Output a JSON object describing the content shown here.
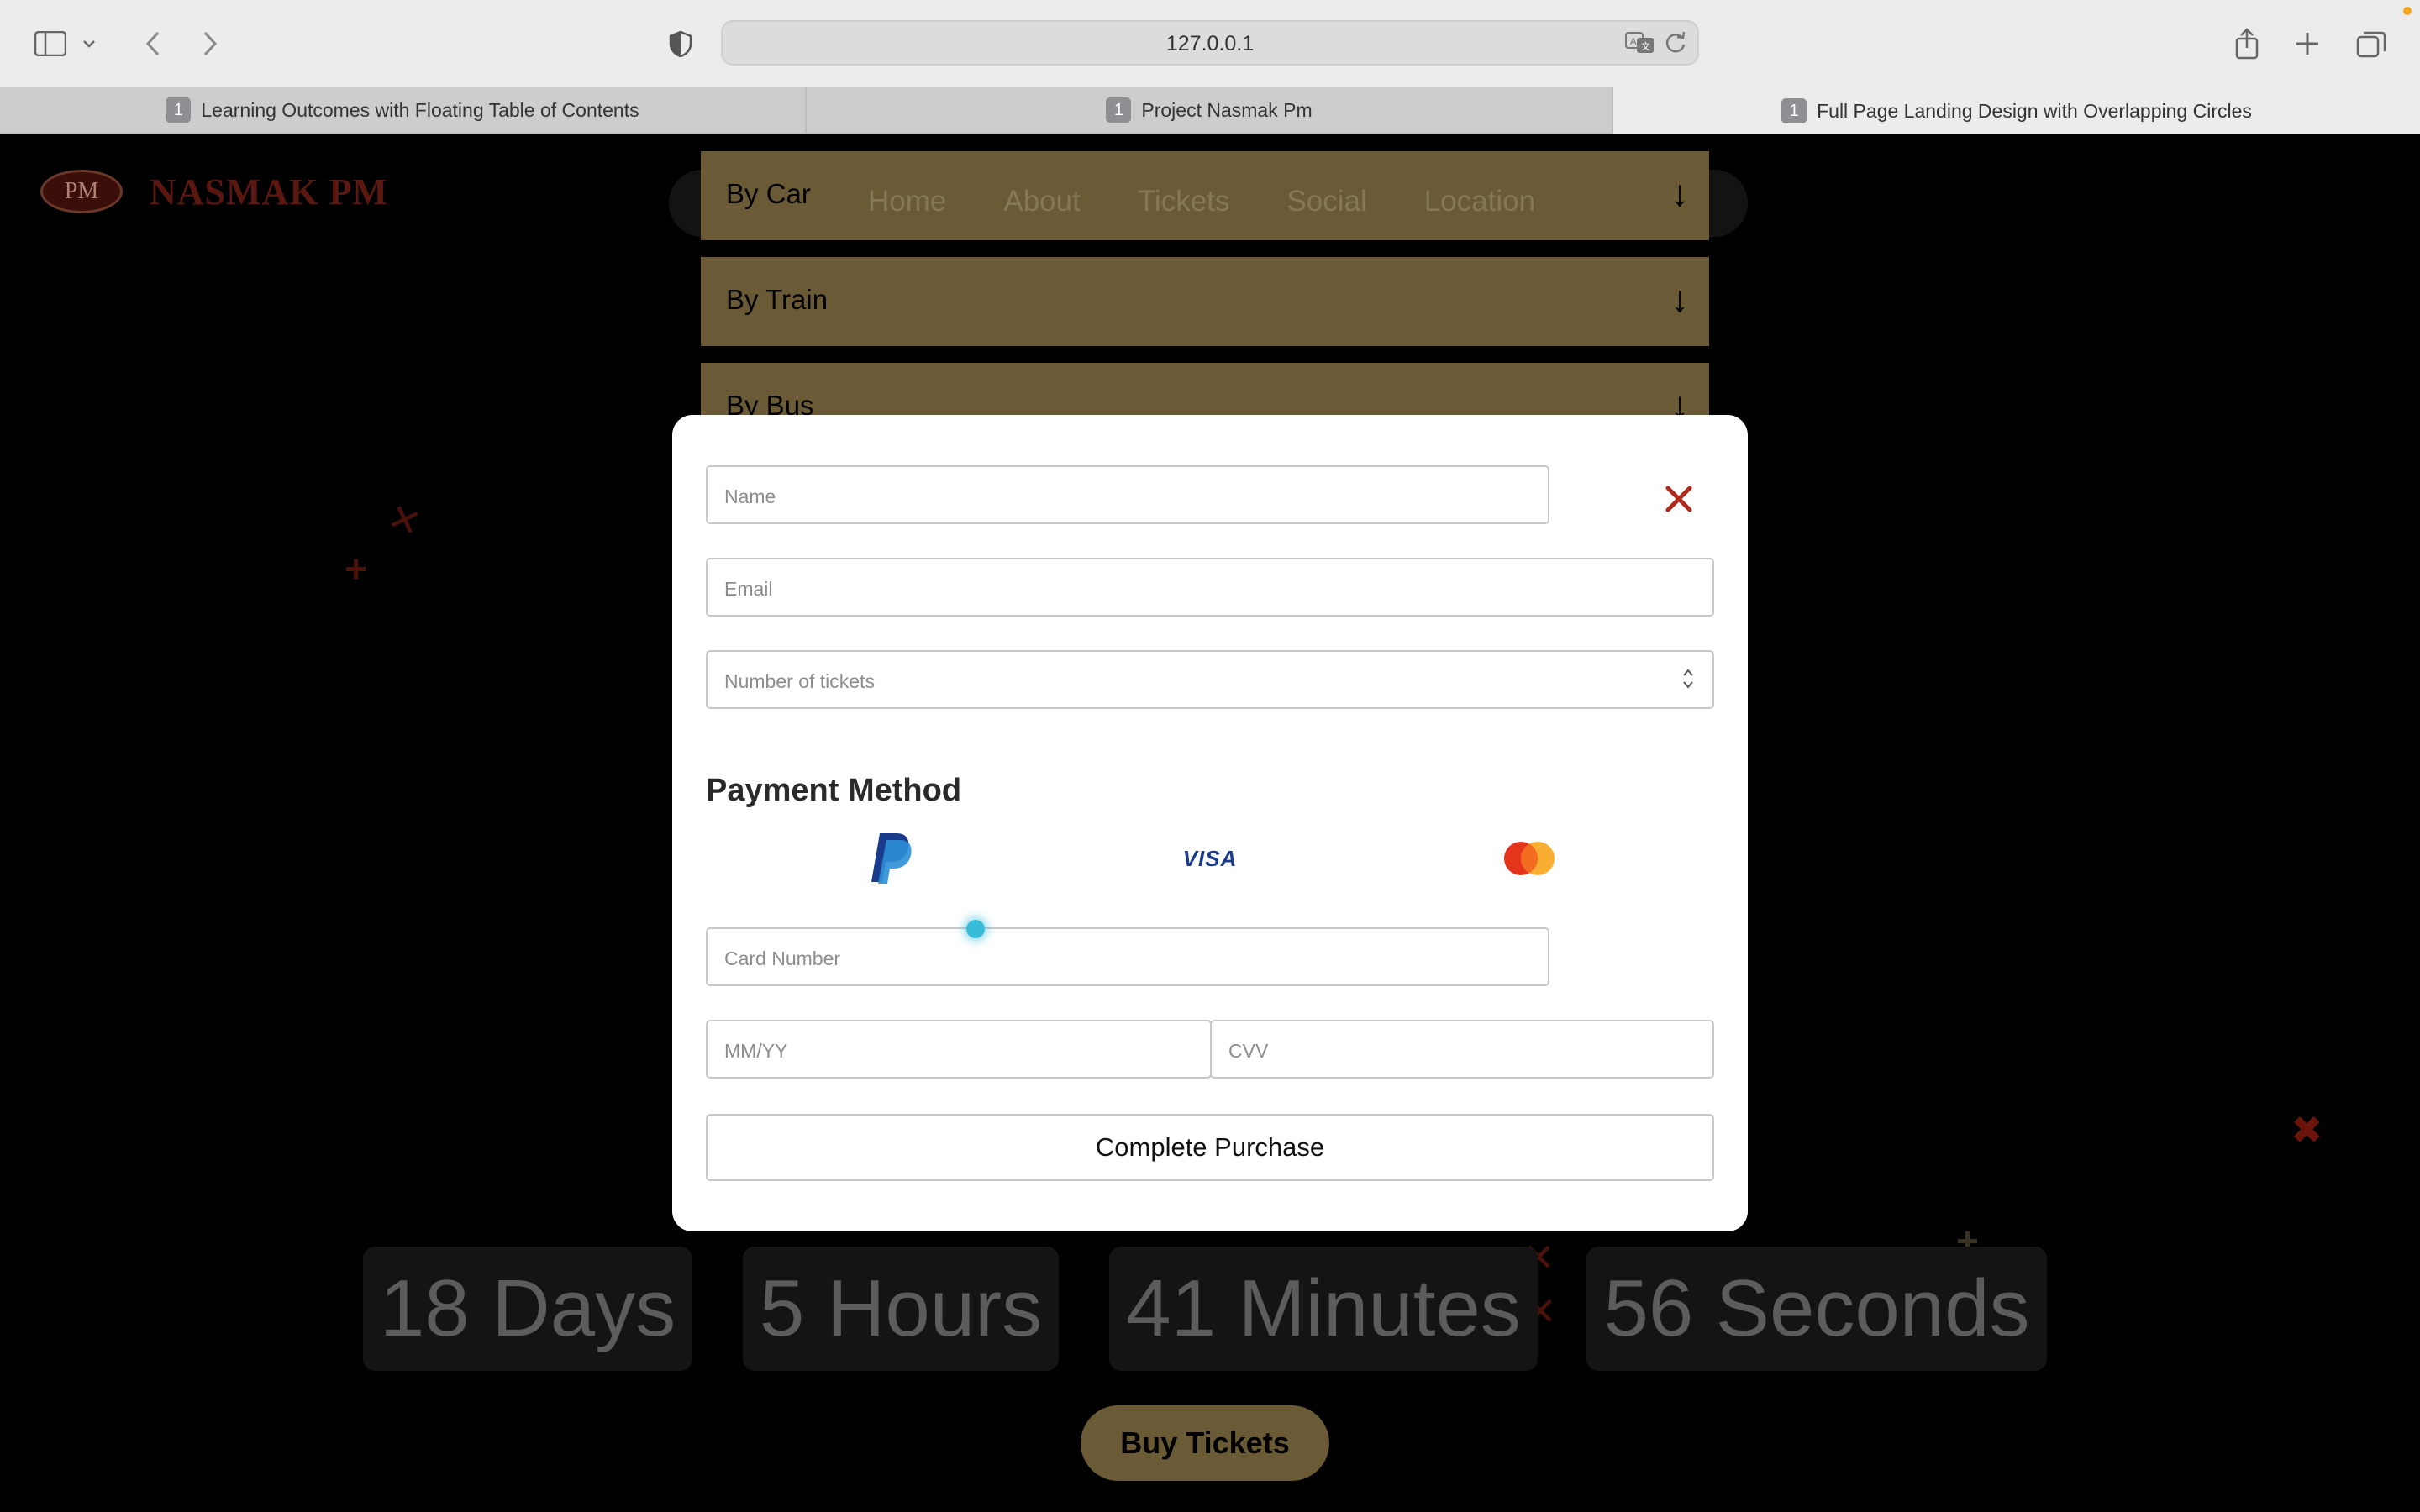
{
  "browser": {
    "url": "127.0.0.1",
    "tabs": [
      {
        "count": "1",
        "title": "Learning Outcomes with Floating Table of Contents"
      },
      {
        "count": "1",
        "title": "Project Nasmak Pm"
      },
      {
        "count": "1",
        "title": "Full Page Landing Design with Overlapping Circles"
      }
    ]
  },
  "site": {
    "logo_mark": "PM",
    "logo_text": "NASMAK PM",
    "nav": [
      "Home",
      "About",
      "Tickets",
      "Social",
      "Location"
    ],
    "accordion": [
      {
        "label": "By Car",
        "arrow": "↓"
      },
      {
        "label": "By Train",
        "arrow": "↓"
      },
      {
        "label": "By Bus",
        "arrow": "↓"
      }
    ],
    "countdown": [
      "18 Days",
      "5 Hours",
      "41 Minutes",
      "56 Seconds"
    ],
    "buy_label": "Buy Tickets"
  },
  "modal": {
    "name_placeholder": "Name",
    "email_placeholder": "Email",
    "tickets_placeholder": "Number of tickets",
    "payment_title": "Payment Method",
    "payment_options": [
      "paypal-icon",
      "visa-icon",
      "mastercard-icon"
    ],
    "visa_text": "VISA",
    "card_placeholder": "Card Number",
    "expiry_placeholder": "MM/YY",
    "cvv_placeholder": "CVV",
    "submit_label": "Complete Purchase"
  },
  "colors": {
    "accent_gold": "#6a5a36",
    "close_red": "#b02a1e",
    "logo_red": "#5a1810"
  }
}
